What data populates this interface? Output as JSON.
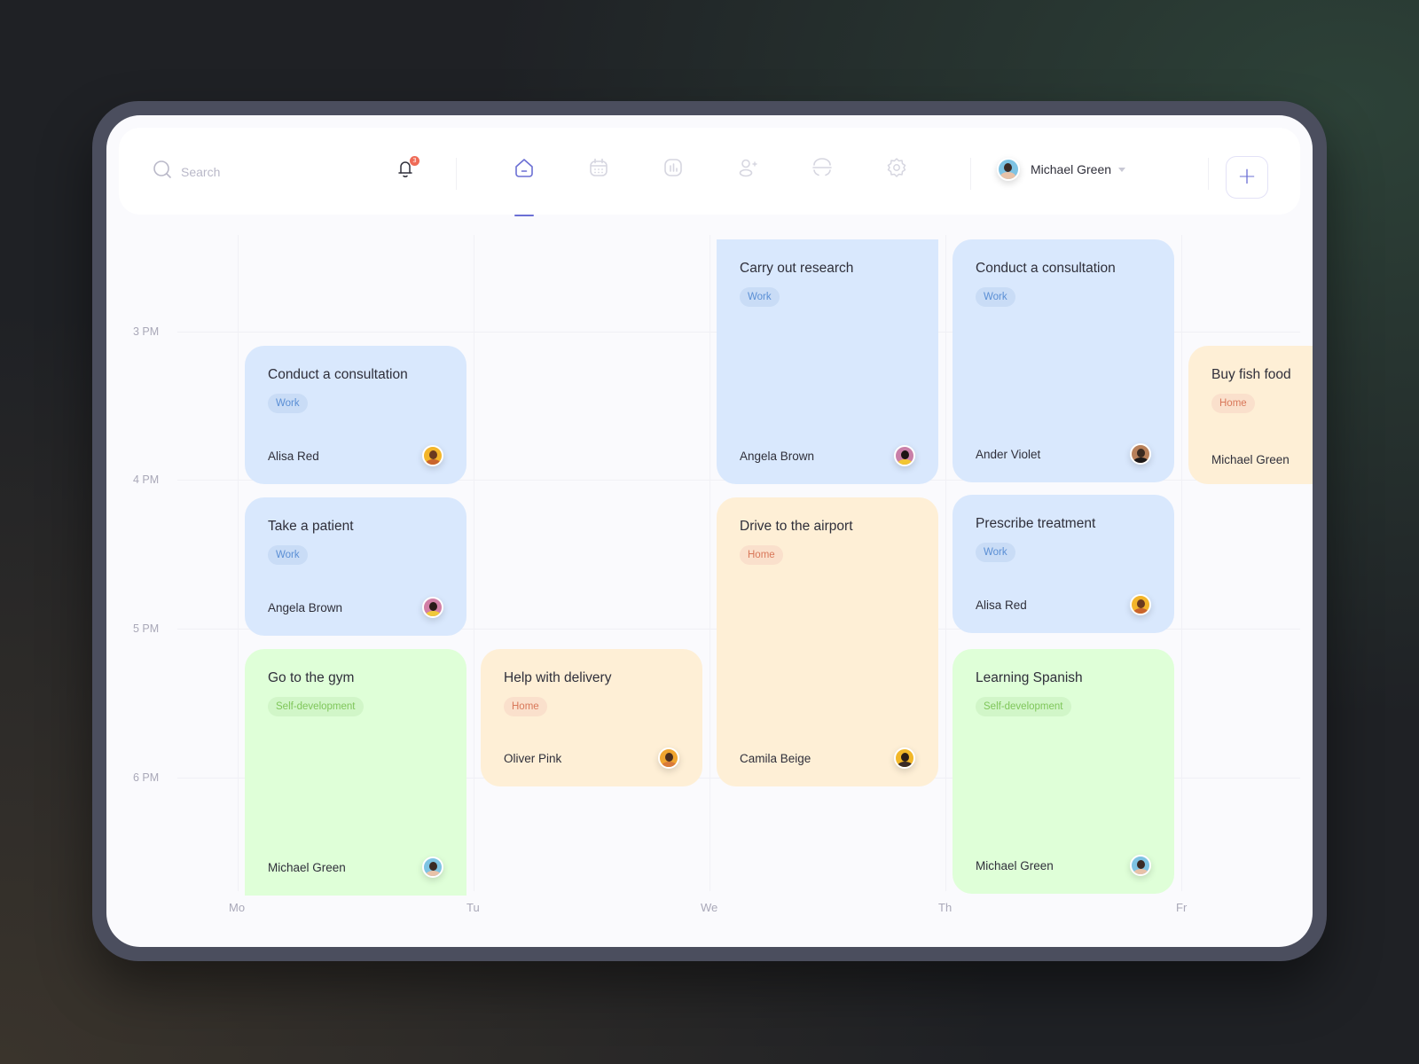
{
  "header": {
    "search": {
      "placeholder": "Search",
      "value": ""
    },
    "notifications": {
      "icon": "bell-icon",
      "count": "3"
    },
    "nav": [
      {
        "name": "home",
        "icon": "home-icon",
        "active": true
      },
      {
        "name": "calendar",
        "icon": "calendar-icon",
        "active": false
      },
      {
        "name": "stats",
        "icon": "chart-icon",
        "active": false
      },
      {
        "name": "add-user",
        "icon": "add-user-icon",
        "active": false
      },
      {
        "name": "scan",
        "icon": "scan-icon",
        "active": false
      },
      {
        "name": "settings",
        "icon": "gear-icon",
        "active": false
      }
    ],
    "user": {
      "name": "Michael Green"
    },
    "add_button_label": "+"
  },
  "colors": {
    "accent": "#6b6fd4",
    "work_bg": "#d9e8fd",
    "home_bg": "#feefd6",
    "self_bg": "#dfffd8",
    "badge": "#ef6b57"
  },
  "calendar": {
    "time_labels": [
      "3 PM",
      "4 PM",
      "5 PM",
      "6 PM"
    ],
    "day_labels": [
      "Mo",
      "Tu",
      "We",
      "Th",
      "Fr"
    ],
    "events": [
      {
        "title": "Conduct a consultation",
        "tag": "Work",
        "assignee": "Alisa Red",
        "day": "Mo",
        "start": "3:00 PM",
        "end": "4:00 PM"
      },
      {
        "title": "Take a patient",
        "tag": "Work",
        "assignee": "Angela Brown",
        "day": "Mo",
        "start": "4:00 PM",
        "end": "5:00 PM"
      },
      {
        "title": "Go to the gym",
        "tag": "Self-development",
        "assignee": "Michael Green",
        "day": "Mo",
        "start": "5:00 PM",
        "end": "6:40 PM"
      },
      {
        "title": "Help with delivery",
        "tag": "Home",
        "assignee": "Oliver Pink",
        "day": "Tu",
        "start": "5:00 PM",
        "end": "6:00 PM"
      },
      {
        "title": "Carry out research",
        "tag": "Work",
        "assignee": "Angela Brown",
        "day": "We",
        "start": "2:20 PM",
        "end": "4:00 PM"
      },
      {
        "title": "Drive to the airport",
        "tag": "Home",
        "assignee": "Camila Beige",
        "day": "We",
        "start": "4:00 PM",
        "end": "6:00 PM"
      },
      {
        "title": "Conduct a consultation",
        "tag": "Work",
        "assignee": "Ander Violet",
        "day": "Th",
        "start": "2:20 PM",
        "end": "4:00 PM"
      },
      {
        "title": "Prescribe treatment",
        "tag": "Work",
        "assignee": "Alisa Red",
        "day": "Th",
        "start": "4:00 PM",
        "end": "5:00 PM"
      },
      {
        "title": "Learning Spanish",
        "tag": "Self-development",
        "assignee": "Michael Green",
        "day": "Th",
        "start": "5:00 PM",
        "end": "6:40 PM"
      },
      {
        "title": "Buy fish food",
        "tag": "Home",
        "assignee": "Michael Green",
        "day": "Fr",
        "start": "3:00 PM",
        "end": "4:00 PM"
      }
    ]
  }
}
